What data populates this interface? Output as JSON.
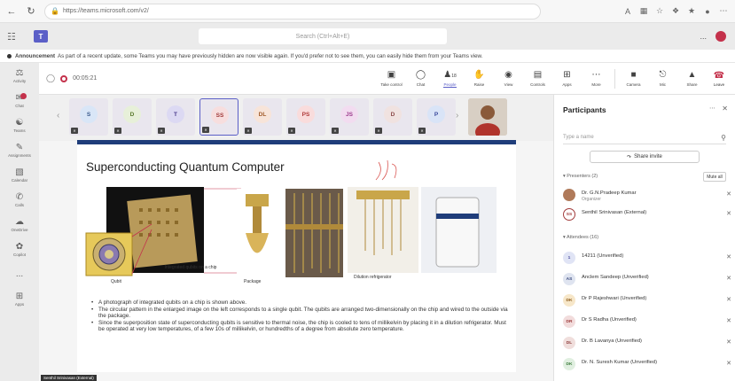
{
  "browser": {
    "url": "https://teams.microsoft.com/v2/"
  },
  "header": {
    "search_placeholder": "Search (Ctrl+Alt+E)",
    "more": "..."
  },
  "announcement": {
    "bold": "Announcement",
    "text": "As part of a recent update, some Teams you may have previously hidden are now visible again. If you'd prefer not to see them, you can easily hide them from your Teams view."
  },
  "rail": {
    "items": [
      {
        "label": "Activity",
        "icon": "bell-icon"
      },
      {
        "label": "Chat",
        "icon": "chat-icon"
      },
      {
        "label": "Teams",
        "icon": "teams-icon"
      },
      {
        "label": "Assignments",
        "icon": "assignments-icon"
      },
      {
        "label": "Calendar",
        "icon": "calendar-icon"
      },
      {
        "label": "Calls",
        "icon": "phone-icon"
      },
      {
        "label": "OneDrive",
        "icon": "cloud-icon"
      },
      {
        "label": "Copilot",
        "icon": "copilot-icon"
      },
      {
        "label": "...",
        "icon": "more-icon"
      },
      {
        "label": "Apps",
        "icon": "apps-icon"
      }
    ]
  },
  "meeting": {
    "timer": "00:05:21",
    "tools": [
      {
        "label": "Take control",
        "icon": "take-control-icon"
      },
      {
        "label": "Chat",
        "icon": "chat-icon"
      },
      {
        "label": "People",
        "icon": "people-icon",
        "badge": "18",
        "active": true
      },
      {
        "label": "Raise",
        "icon": "raise-hand-icon"
      },
      {
        "label": "View",
        "icon": "view-icon"
      },
      {
        "label": "Controls",
        "icon": "controls-icon"
      },
      {
        "label": "Apps",
        "icon": "apps-icon"
      },
      {
        "label": "More",
        "icon": "more-icon"
      }
    ],
    "media": [
      {
        "label": "Camera",
        "icon": "camera-off-icon"
      },
      {
        "label": "Mic",
        "icon": "mic-off-icon"
      },
      {
        "label": "Share",
        "icon": "share-icon"
      }
    ],
    "leave_label": "Leave"
  },
  "gallery": {
    "tiles": [
      {
        "initials": "S",
        "bg": "#d9e6f7",
        "fg": "#3a5a8c"
      },
      {
        "initials": "D",
        "bg": "#e7f0d9",
        "fg": "#5a7a2c"
      },
      {
        "initials": "T",
        "bg": "#dcd9f3",
        "fg": "#4a3a8c"
      },
      {
        "initials": "SS",
        "bg": "#f7dede",
        "fg": "#a13a3a",
        "selected": true
      },
      {
        "initials": "DL",
        "bg": "#f7e4d9",
        "fg": "#a15a2a"
      },
      {
        "initials": "PS",
        "bg": "#f9dcdc",
        "fg": "#b03a3a"
      },
      {
        "initials": "JS",
        "bg": "#f2dcf0",
        "fg": "#9c3a8c"
      },
      {
        "initials": "D",
        "bg": "#f0e2e0",
        "fg": "#8c4a4a"
      },
      {
        "initials": "P",
        "bg": "#d9e4f7",
        "fg": "#3a4a9c"
      }
    ]
  },
  "slide": {
    "title": "Superconducting Quantum Computer",
    "captions": {
      "qubit": "Qubit",
      "chip": "Integrated qubits on a chip",
      "package": "Package",
      "fridge": "Dilution refrigerator"
    },
    "bullets": [
      "A photograph of integrated qubits on a chip is shown above.",
      "The circular pattern in the enlarged image on the left corresponds to a single qubit. The qubits are arranged two-dimensionally on the chip and wired to the outside via the package.",
      "Since the superposition state of superconducting qubits is sensitive to thermal noise, the chip is cooled to tens of millikelvin by placing it in a dilution refrigerator. Must be operated at very low temperatures, of a few 10s of millikelvin, or hundredths of a degree from absolute zero temperature."
    ],
    "presenter": "Senthil Srinivasan (External)"
  },
  "participants": {
    "title": "Participants",
    "search_placeholder": "Type a name",
    "share_invite": "Share invite",
    "presenters_label": "Presenters (2)",
    "mute_all": "Mute all",
    "attendees_label": "Attendees (16)",
    "presenters": [
      {
        "initials": "",
        "name": "Dr. G.N.Pradeep Kumar",
        "role": "Organizer",
        "bg": "#b07a5a",
        "fg": "#fff",
        "photo": true
      },
      {
        "initials": "SS",
        "name": "Senthil Srinivasan (External)",
        "role": "",
        "bg": "#fff",
        "fg": "#a13a3a",
        "ring": true
      }
    ],
    "attendees": [
      {
        "initials": "1",
        "name": "14211 (Unverified)",
        "bg": "#e0e4f5",
        "fg": "#4a4a9c"
      },
      {
        "initials": "AS",
        "name": "Anclem Sandeep (Unverified)",
        "bg": "#dfe4f0",
        "fg": "#3a4a7c"
      },
      {
        "initials": "DK",
        "name": "Dr P Rajeshwari (Unverified)",
        "bg": "#f7e7c9",
        "fg": "#8c5a1a"
      },
      {
        "initials": "DR",
        "name": "Dr S Radha (Unverified)",
        "bg": "#f2dcdc",
        "fg": "#9c3a3a"
      },
      {
        "initials": "DL",
        "name": "Dr. B Lavanya (Unverified)",
        "bg": "#f0dedc",
        "fg": "#8c3a3a"
      },
      {
        "initials": "DK",
        "name": "Dr. N. Suresh Kumar (Unverified)",
        "bg": "#e0efe0",
        "fg": "#3a7a3a"
      }
    ]
  }
}
